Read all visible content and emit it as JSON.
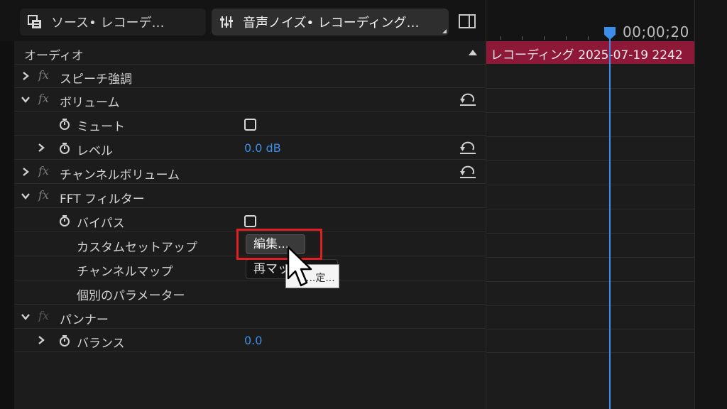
{
  "tabs": [
    {
      "label": "ソース• レコーデ…",
      "icon": "source-monitor-icon"
    },
    {
      "label": "音声ノイズ• レコーディング…",
      "icon": "effect-controls-icon"
    }
  ],
  "panel": {
    "section_header": "オーディオ",
    "rows": {
      "speech_enhance": "スピーチ強調",
      "volume": "ボリューム",
      "mute": "ミュート",
      "level": "レベル",
      "level_value": "0.0 dB",
      "channel_volume": "チャンネルボリューム",
      "fft_filter": "FFT フィルター",
      "bypass": "バイパス",
      "custom_setup": "カスタムセットアップ",
      "custom_setup_button": "編集...",
      "channel_map": "チャンネルマップ",
      "channel_map_button": "再マッピング...",
      "individual_params": "個別のパラメーター",
      "panner": "パンナー",
      "balance": "バランス",
      "balance_value": "0.0"
    },
    "fx_label": "fx",
    "tooltip": "...定..."
  },
  "timeline": {
    "timecode": "00;00;20",
    "clip_name": "レコーディング 2025-07-19 2242"
  },
  "colors": {
    "accent": "#3b8eea",
    "value_blue": "#3d8fe6",
    "clip": "#8e1837",
    "highlight": "#e02020"
  }
}
